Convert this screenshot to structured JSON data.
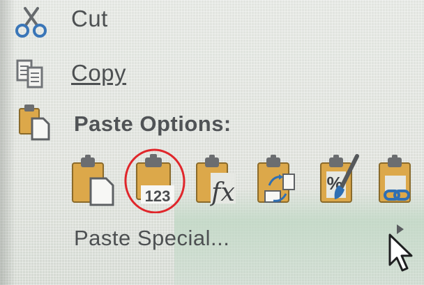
{
  "menu": {
    "cut": {
      "label": "Cut",
      "icon": "scissors-icon"
    },
    "copy": {
      "label": "Copy",
      "icon": "copy-icon"
    },
    "paste_options_header": {
      "label": "Paste Options:",
      "icon": "paste-icon"
    },
    "paste_buttons": [
      {
        "name": "paste-keep-source-button",
        "icon": "clipboard-page-icon"
      },
      {
        "name": "paste-values-button",
        "icon": "clipboard-values-icon",
        "glyph": "123",
        "highlighted": true
      },
      {
        "name": "paste-formulas-button",
        "icon": "clipboard-formula-icon",
        "glyph": "fx"
      },
      {
        "name": "paste-transpose-button",
        "icon": "clipboard-transpose-icon"
      },
      {
        "name": "paste-formatting-button",
        "icon": "clipboard-format-icon",
        "glyph": "%"
      },
      {
        "name": "paste-link-button",
        "icon": "clipboard-link-icon"
      }
    ],
    "paste_special": {
      "label": "Paste Special...",
      "has_submenu": true
    }
  },
  "colors": {
    "text": "#4d5052",
    "clipboard": "#d9a441",
    "clipboard_dark": "#6b6d70",
    "highlight_circle": "#e0262b",
    "accent_blue": "#2f6fb3"
  }
}
